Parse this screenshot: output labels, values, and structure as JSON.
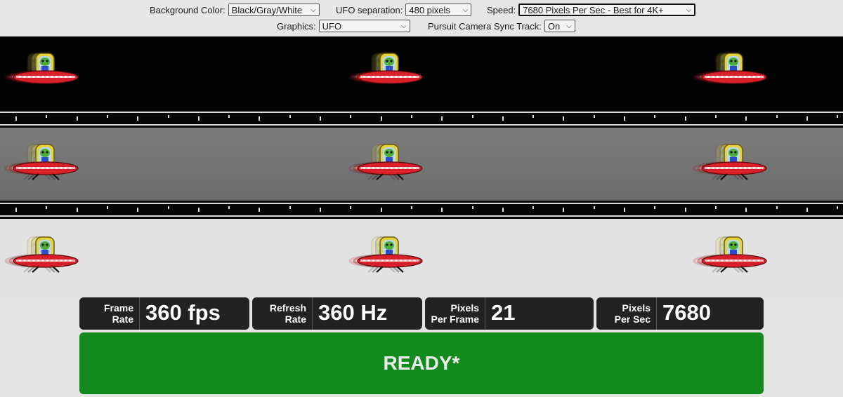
{
  "controls": {
    "background_color": {
      "label": "Background Color:",
      "value": "Black/Gray/White"
    },
    "ufo_separation": {
      "label": "UFO separation:",
      "value": "480 pixels"
    },
    "speed": {
      "label": "Speed:",
      "value": "7680 Pixels Per Sec - Best for 4K+"
    },
    "graphics": {
      "label": "Graphics:",
      "value": "UFO"
    },
    "pursuit_camera": {
      "label": "Pursuit Camera Sync Track:",
      "value": "On"
    }
  },
  "lanes": [
    "black",
    "gray",
    "white"
  ],
  "colors": {
    "lane_black": "#030303",
    "lane_gray": "#747474",
    "lane_white": "#e2e2e2",
    "ready_green": "#138a1d",
    "stat_bg": "#222222"
  },
  "stats": [
    {
      "label_line1": "Frame",
      "label_line2": "Rate",
      "value": "360 fps"
    },
    {
      "label_line1": "Refresh",
      "label_line2": "Rate",
      "value": "360 Hz"
    },
    {
      "label_line1": "Pixels",
      "label_line2": "Per Frame",
      "value": "21"
    },
    {
      "label_line1": "Pixels",
      "label_line2": "Per Sec",
      "value": "7680"
    }
  ],
  "status": {
    "text": "READY*"
  }
}
